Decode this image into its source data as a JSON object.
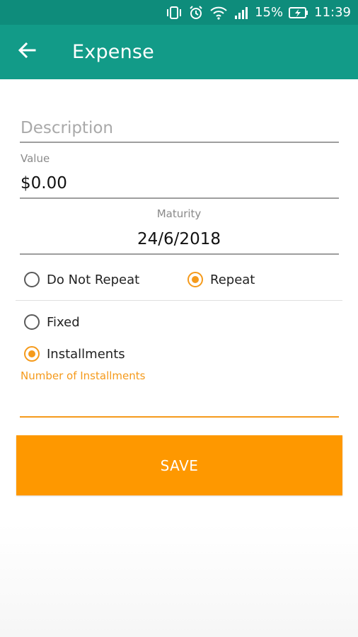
{
  "status_bar": {
    "battery": "15%",
    "time": "11:39",
    "icons": [
      "vibrate-icon",
      "alarm-icon",
      "wifi-icon",
      "signal-icon",
      "battery-charging-icon"
    ]
  },
  "app_bar": {
    "title": "Expense",
    "back_icon": "arrow-back-icon"
  },
  "form": {
    "description": {
      "placeholder": "Description",
      "value": ""
    },
    "value": {
      "label": "Value",
      "value": "$0.00"
    },
    "maturity": {
      "label": "Maturity",
      "value": "24/6/2018"
    },
    "repeat_options": [
      {
        "label": "Do Not Repeat",
        "checked": false
      },
      {
        "label": "Repeat",
        "checked": true
      }
    ],
    "repeat_type_options": [
      {
        "label": "Fixed",
        "checked": false
      },
      {
        "label": "Installments",
        "checked": true
      }
    ],
    "installments": {
      "label": "Number of Installments",
      "value": ""
    },
    "save_label": "SAVE"
  },
  "colors": {
    "status_bar": "#0e8c7b",
    "app_bar": "#129b88",
    "accent": "#fe9800"
  }
}
